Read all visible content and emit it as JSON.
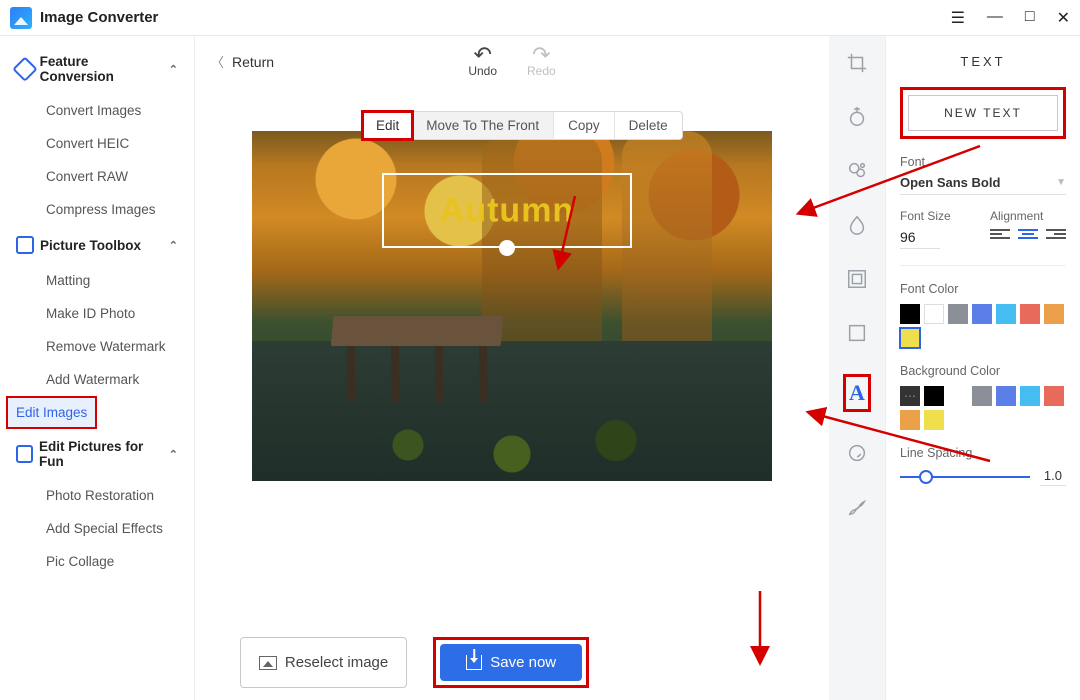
{
  "app_title": "Image Converter",
  "sidebar": {
    "group1": {
      "title": "Feature Conversion",
      "items": [
        "Convert Images",
        "Convert HEIC",
        "Convert RAW",
        "Compress Images"
      ]
    },
    "group2": {
      "title": "Picture Toolbox",
      "items": [
        "Matting",
        "Make ID Photo",
        "Remove Watermark",
        "Add Watermark",
        "Edit Images"
      ]
    },
    "group3": {
      "title": "Edit Pictures for Fun",
      "items": [
        "Photo Restoration",
        "Add Special Effects",
        "Pic Collage"
      ]
    }
  },
  "editor": {
    "return": "Return",
    "undo": "Undo",
    "redo": "Redo",
    "ctx": {
      "edit": "Edit",
      "mtf": "Move To The Front",
      "copy": "Copy",
      "del": "Delete"
    },
    "overlay_text": "Autumn",
    "reselect": "Reselect image",
    "save": "Save now"
  },
  "text_panel": {
    "title": "TEXT",
    "new_text": "NEW TEXT",
    "font_label": "Font",
    "font_value": "Open Sans Bold",
    "font_size_label": "Font Size",
    "font_size_value": "96",
    "alignment_label": "Alignment",
    "font_color_label": "Font Color",
    "font_colors": [
      "#000000",
      "#ffffff",
      "#8a8f98",
      "#5b7ee8",
      "#45bdf0",
      "#e86a5b",
      "#eba049",
      "#f0df4d"
    ],
    "font_color_selected": 7,
    "bg_label": "Background Color",
    "bg_colors": [
      "#000000",
      "no",
      "#8a8f98",
      "#5b7ee8",
      "#45bdf0",
      "#e86a5b",
      "#eba049",
      "#f0df4d"
    ],
    "line_spacing_label": "Line Spacing",
    "line_spacing_value": "1.0"
  }
}
